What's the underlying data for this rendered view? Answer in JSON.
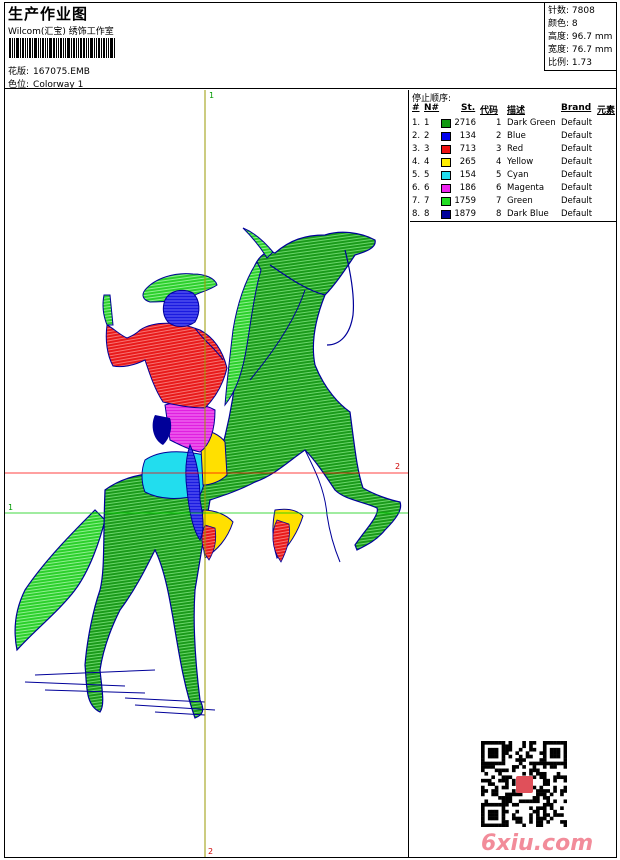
{
  "header": {
    "title": "生产作业图",
    "subtitle": "Wilcom(汇宝) 绣饰工作室",
    "pattern_label": "花版:",
    "pattern_value": "167075.EMB",
    "colorway_label": "色位:",
    "colorway_value": "Colorway 1"
  },
  "stats": [
    {
      "label": "针数:",
      "value": "7808"
    },
    {
      "label": "颜色:",
      "value": "8"
    },
    {
      "label": "高度:",
      "value": "96.7 mm"
    },
    {
      "label": "宽度:",
      "value": "76.7 mm"
    },
    {
      "label": "比例:",
      "value": "1.73"
    }
  ],
  "guides": {
    "v_top": "1",
    "v_bottom": "2",
    "h_red": "2",
    "h_green": "1"
  },
  "stop_sequence": {
    "title": "停止顺序:",
    "headers": {
      "num": "#",
      "n": "N#",
      "st": "St.",
      "code": "代码",
      "desc": "描述",
      "brand": "Brand",
      "element": "元素"
    },
    "rows": [
      {
        "num": "1.",
        "n": "1",
        "color": "#119911",
        "st": "2716",
        "code": "1",
        "desc": "Dark Green",
        "brand": "Default"
      },
      {
        "num": "2.",
        "n": "2",
        "color": "#0000ee",
        "st": "134",
        "code": "2",
        "desc": "Blue",
        "brand": "Default"
      },
      {
        "num": "3.",
        "n": "3",
        "color": "#ee1111",
        "st": "713",
        "code": "3",
        "desc": "Red",
        "brand": "Default"
      },
      {
        "num": "4.",
        "n": "4",
        "color": "#ffee00",
        "st": "265",
        "code": "4",
        "desc": "Yellow",
        "brand": "Default"
      },
      {
        "num": "5.",
        "n": "5",
        "color": "#22ddee",
        "st": "154",
        "code": "5",
        "desc": "Cyan",
        "brand": "Default"
      },
      {
        "num": "6.",
        "n": "6",
        "color": "#ee22ee",
        "st": "186",
        "code": "6",
        "desc": "Magenta",
        "brand": "Default"
      },
      {
        "num": "7.",
        "n": "7",
        "color": "#22dd22",
        "st": "1759",
        "code": "7",
        "desc": "Green",
        "brand": "Default"
      },
      {
        "num": "8.",
        "n": "8",
        "color": "#000099",
        "st": "1879",
        "code": "8",
        "desc": "Dark Blue",
        "brand": "Default"
      }
    ]
  },
  "watermark": "6xiu.com"
}
